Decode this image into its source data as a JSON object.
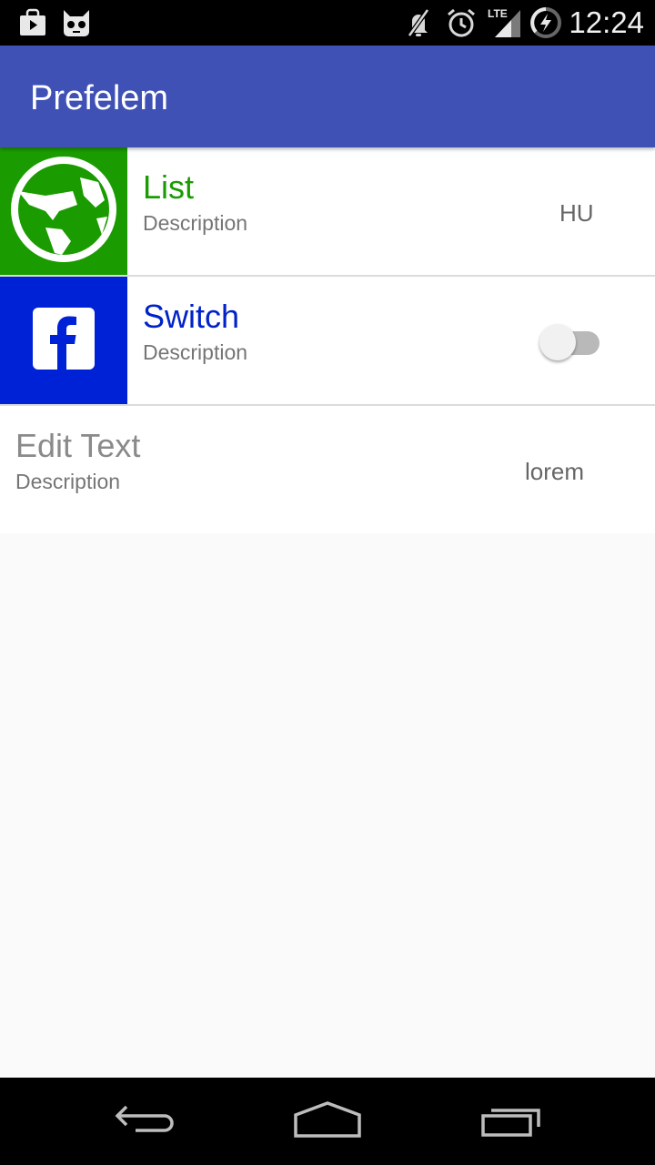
{
  "status_bar": {
    "time": "12:24",
    "icons": [
      "play-store-bag-icon",
      "cyanogenmod-mascot-icon",
      "muted-icon",
      "alarm-icon",
      "lte-signal-icon",
      "battery-charging-icon"
    ],
    "network_label": "LTE"
  },
  "app_bar": {
    "title": "Prefelem",
    "color": "#3f51b5"
  },
  "preferences": [
    {
      "type": "list",
      "title": "List",
      "description": "Description",
      "value": "HU",
      "icon": "globe-icon",
      "tile_color": "#1a9c00",
      "title_color": "#1a9c00"
    },
    {
      "type": "switch",
      "title": "Switch",
      "description": "Description",
      "checked": false,
      "icon": "facebook-icon",
      "tile_color": "#0022d6",
      "title_color": "#0022c8"
    },
    {
      "type": "edit_text",
      "title": "Edit Text",
      "description": "Description",
      "value": "lorem",
      "title_color": "#8a8a8a"
    }
  ],
  "nav_bar": {
    "buttons": [
      "back-icon",
      "home-icon",
      "recents-icon"
    ]
  }
}
